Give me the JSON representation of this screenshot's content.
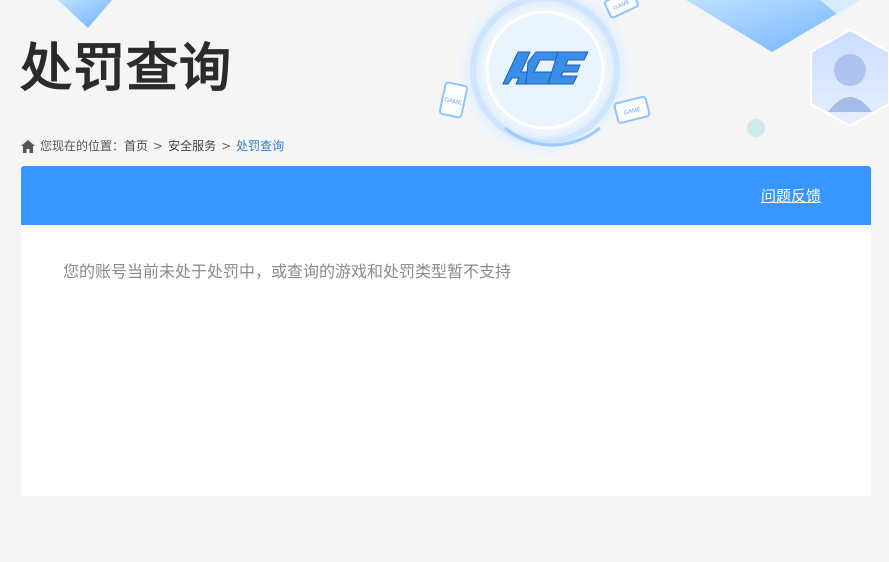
{
  "header": {
    "title": "处罚查询",
    "logo_text": "ACE",
    "badge_text": "GAME"
  },
  "breadcrumb": {
    "prefix": "您现在的位置：",
    "items": [
      "首页",
      "安全服务",
      "处罚查询"
    ],
    "separator": ">"
  },
  "panel": {
    "feedback_label": "问题反馈",
    "message": "您的账号当前未处于处罚中，或查询的游戏和处罚类型暂不支持"
  },
  "colors": {
    "accent": "#3796ff",
    "background": "#f5f5f5",
    "title": "#2b2b2b",
    "message": "#8a8a8a",
    "current_crumb": "#2f7fc8"
  },
  "icons": [
    "home-icon",
    "ace-logo-icon",
    "game-tablet-icon",
    "game-phone-icon",
    "game-monitor-icon",
    "character-portrait-icon"
  ]
}
